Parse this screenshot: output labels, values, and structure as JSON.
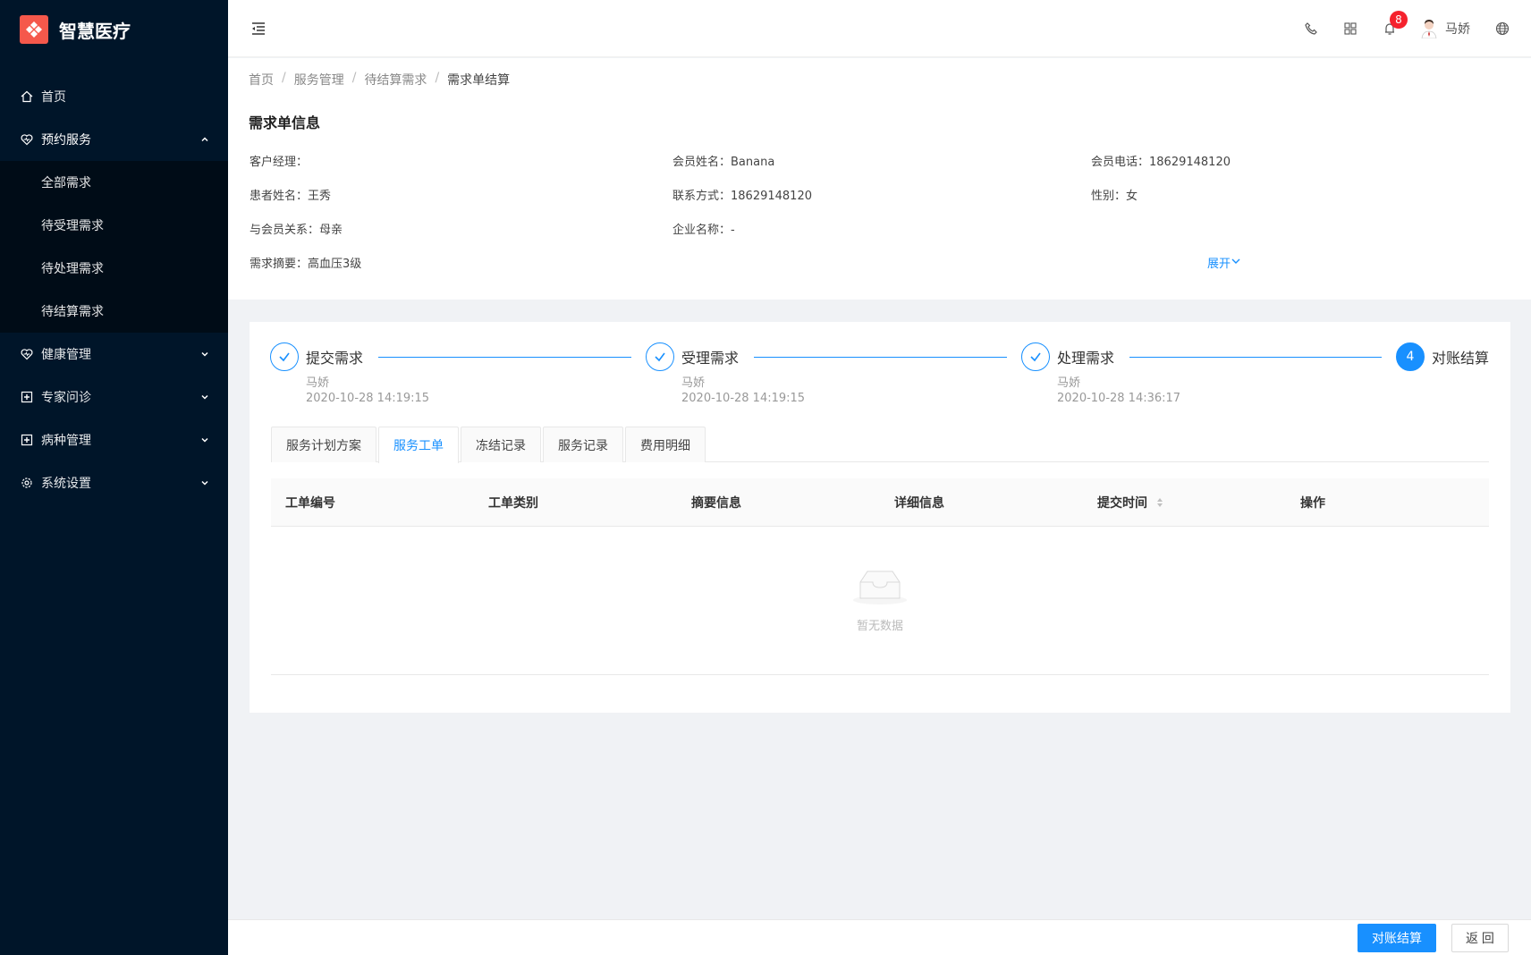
{
  "app": {
    "name": "智慧医疗"
  },
  "sidebar": {
    "items": [
      {
        "label": "首页",
        "icon": "home-icon"
      },
      {
        "label": "预约服务",
        "icon": "heart-icon",
        "open": true,
        "children": [
          {
            "label": "全部需求"
          },
          {
            "label": "待受理需求"
          },
          {
            "label": "待处理需求"
          },
          {
            "label": "待结算需求"
          }
        ]
      },
      {
        "label": "健康管理",
        "icon": "heart-pulse-icon"
      },
      {
        "label": "专家问诊",
        "icon": "medical-plus-icon"
      },
      {
        "label": "病种管理",
        "icon": "medical-plus-icon"
      },
      {
        "label": "系统设置",
        "icon": "gear-icon"
      }
    ]
  },
  "header": {
    "notification_count": "8",
    "user_name": "马娇"
  },
  "breadcrumb": [
    "首页",
    "服务管理",
    "待结算需求",
    "需求单结算"
  ],
  "info": {
    "title": "需求单信息",
    "fields": {
      "manager": {
        "label": "客户经理：",
        "value": ""
      },
      "member_name": {
        "label": "会员姓名：",
        "value": "Banana"
      },
      "member_phone": {
        "label": "会员电话：",
        "value": "18629148120"
      },
      "patient_name": {
        "label": "患者姓名：",
        "value": "王秀"
      },
      "contact": {
        "label": "联系方式：",
        "value": "18629148120"
      },
      "gender": {
        "label": "性别：",
        "value": "女"
      },
      "relation": {
        "label": "与会员关系：",
        "value": "母亲"
      },
      "company": {
        "label": "企业名称：",
        "value": "-"
      },
      "summary": {
        "label": "需求摘要：",
        "value": "高血压3级"
      }
    },
    "expand_label": "展开"
  },
  "steps": [
    {
      "title": "提交需求",
      "person": "马娇",
      "time": "2020-10-28 14:19:15",
      "status": "done"
    },
    {
      "title": "受理需求",
      "person": "马娇",
      "time": "2020-10-28 14:19:15",
      "status": "done"
    },
    {
      "title": "处理需求",
      "person": "马娇",
      "time": "2020-10-28 14:36:17",
      "status": "done"
    },
    {
      "title": "对账结算",
      "number": "4",
      "status": "active"
    }
  ],
  "tabs": [
    {
      "label": "服务计划方案"
    },
    {
      "label": "服务工单",
      "active": true
    },
    {
      "label": "冻结记录"
    },
    {
      "label": "服务记录"
    },
    {
      "label": "费用明细"
    }
  ],
  "table": {
    "columns": [
      "工单编号",
      "工单类别",
      "摘要信息",
      "详细信息",
      "提交时间",
      "操作"
    ],
    "empty_text": "暂无数据"
  },
  "footer": {
    "confirm_label": "对账结算",
    "back_label": "返 回"
  },
  "colors": {
    "primary": "#1890ff",
    "sidebar": "#001529",
    "brand": "#f5584b",
    "badge": "#f5222d"
  }
}
